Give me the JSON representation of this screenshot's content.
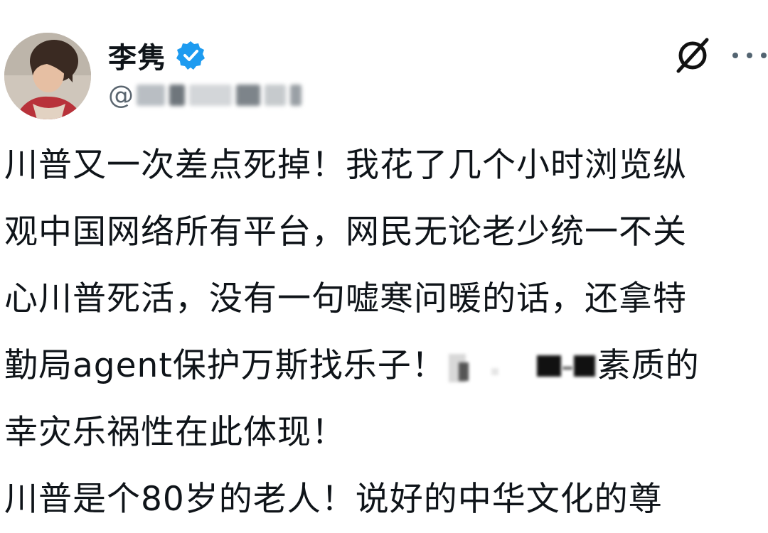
{
  "author": {
    "display_name": "李隽",
    "handle_prefix": "@",
    "verified": true
  },
  "icons": {
    "verified": "verified-badge-icon",
    "grok": "grok-slash-icon",
    "more": "more-dots-icon"
  },
  "post": {
    "line1": "川普又一次差点死掉！我花了几个小时浏览纵",
    "line2": "观中国网络所有平台，网民无论老少统一不关",
    "line3": "心川普死活，没有一句嘘寒问暖的话，还拿特",
    "line4_before": "勤局agent保护万斯找乐子！",
    "line4_after": "素质的",
    "line5": "幸灾乐祸性在此体现！",
    "line6": "川普是个80岁的老人！说好的中华文化的尊"
  },
  "colors": {
    "verified_blue": "#1d9bf0",
    "text": "#0f1419",
    "secondary": "#536471"
  }
}
